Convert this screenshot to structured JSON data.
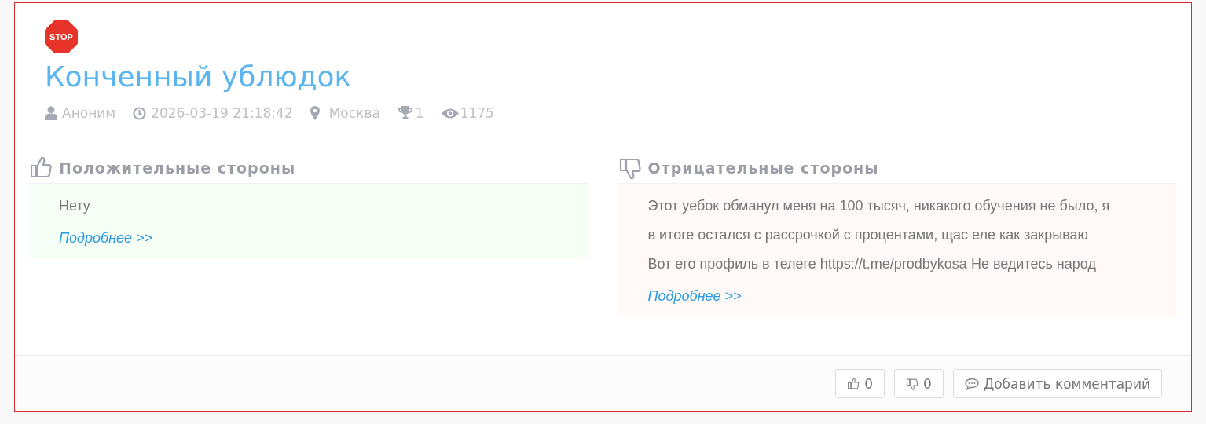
{
  "badge": {
    "label": "STOP"
  },
  "title": "Конченный ублюдок",
  "meta": [
    {
      "kind": "author",
      "text": "Аноним"
    },
    {
      "kind": "date",
      "text": "2026-03-19 21:18:42"
    },
    {
      "kind": "location",
      "text": "Москва"
    },
    {
      "kind": "rank",
      "text": "1"
    },
    {
      "kind": "views",
      "text": "1175"
    }
  ],
  "sections": [
    {
      "kind": "positive",
      "heading": "Положительные стороны",
      "text": "Нету",
      "link": "Подробнее >>"
    },
    {
      "kind": "negative",
      "heading": "Отрицательные стороны",
      "text": "Этот уебок обманул меня на 100 тысяч, никакого обучения не было, я в итоге остался с рассрочкой с процентами, щас еле как закрываю Вот его профиль в телеге https://t.me/prodbykosa Не ведитесь народ",
      "link": "Подробнее >>"
    }
  ],
  "actions": [
    {
      "kind": "like",
      "label": "0"
    },
    {
      "kind": "dislike",
      "label": "0"
    },
    {
      "kind": "comment",
      "label": "Добавить комментарий"
    }
  ]
}
